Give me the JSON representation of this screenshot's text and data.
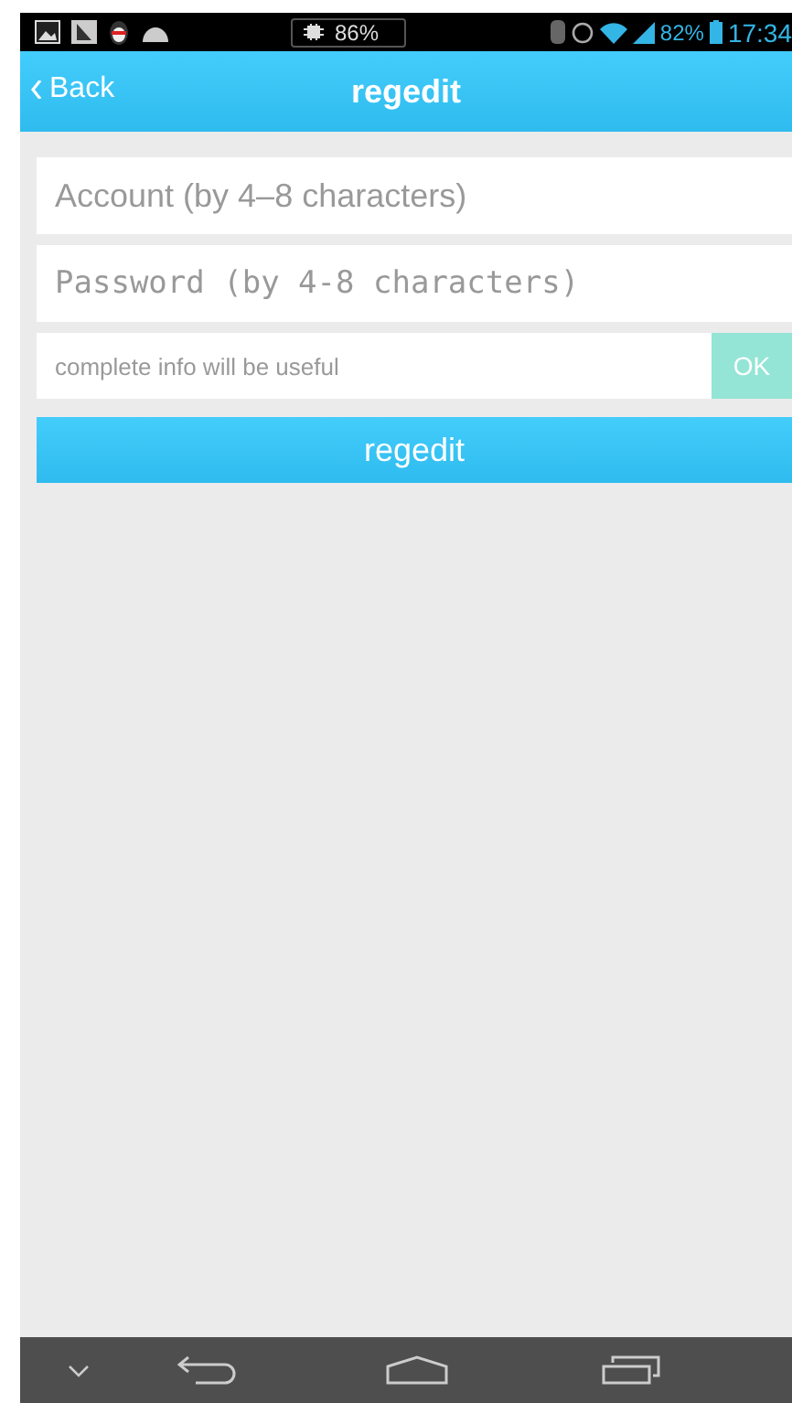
{
  "status_bar": {
    "cpu_readout": "86%",
    "battery_percent": "82%",
    "time": "17:34"
  },
  "header": {
    "back": "Back",
    "title": "regedit"
  },
  "form": {
    "account": {
      "placeholder": "Account (by 4–8 characters)"
    },
    "password": {
      "placeholder": "Password (by 4-8 characters)"
    },
    "info": {
      "placeholder": "complete info will be useful"
    },
    "ok_button": "OK",
    "submit_button": "regedit"
  }
}
